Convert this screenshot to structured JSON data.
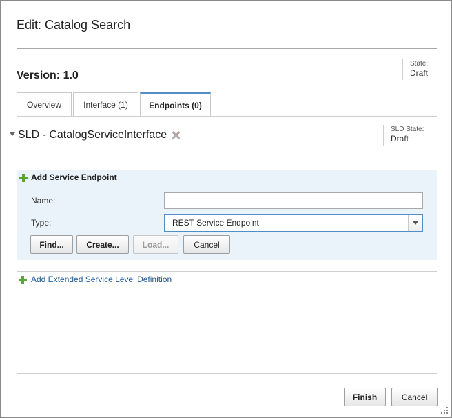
{
  "dialog": {
    "title": "Edit: Catalog Search"
  },
  "version": {
    "label": "Version: 1.0",
    "state_label": "State:",
    "state_value": "Draft"
  },
  "tabs": [
    {
      "label": "Overview",
      "active": false
    },
    {
      "label": "Interface (1)",
      "active": false
    },
    {
      "label": "Endpoints (0)",
      "active": true
    }
  ],
  "sld": {
    "title": "SLD - CatalogServiceInterface",
    "state_label": "SLD State:",
    "state_value": "Draft"
  },
  "add_endpoint": {
    "title": "Add Service Endpoint",
    "name_label": "Name:",
    "name_value": "",
    "type_label": "Type:",
    "type_value": "REST Service Endpoint",
    "buttons": {
      "find": "Find...",
      "create": "Create...",
      "load": "Load...",
      "cancel": "Cancel"
    }
  },
  "extended_link": "Add Extended Service Level Definition",
  "footer": {
    "finish": "Finish",
    "cancel": "Cancel"
  },
  "colors": {
    "accent": "#4f8fc6",
    "panel_bg": "#eaf3fa",
    "link": "#1f5c99",
    "plus": "#5aa53b"
  }
}
